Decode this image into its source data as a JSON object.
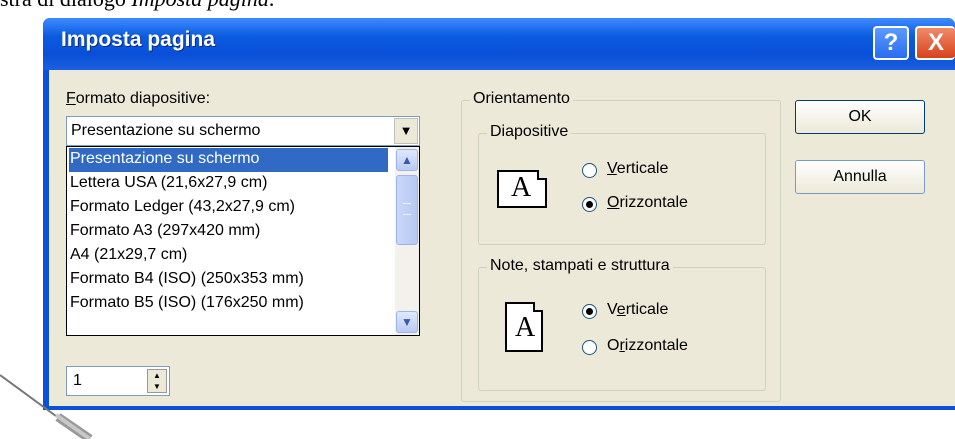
{
  "caption": {
    "text_prefix": "stra di dialogo ",
    "text_emphasis": "Imposta pagina",
    "text_suffix": "."
  },
  "window": {
    "title": "Imposta pagina",
    "help_label": "?",
    "close_label": "X"
  },
  "slide_format": {
    "label_accel": "F",
    "label_rest": "ormato diapositive:",
    "selected": "Presentazione su schermo",
    "options": [
      "Presentazione su schermo",
      "Lettera USA (21,6x27,9 cm)",
      "Formato Ledger (43,2x27,9 cm)",
      "Formato A3 (297x420 mm)",
      "A4 (21x29,7 cm)",
      "Formato B4 (ISO) (250x353 mm)",
      "Formato B5 (ISO) (176x250 mm)"
    ]
  },
  "numbering": {
    "value": "1"
  },
  "orientation": {
    "group_label": "Orientamento",
    "slides": {
      "label": "Diapositive",
      "portrait_accel": "V",
      "portrait_rest": "erticale",
      "landscape_accel": "O",
      "landscape_rest": "rizzontale",
      "selected": "Orizzontale"
    },
    "notes": {
      "label": "Note, stampati e struttura",
      "portrait_pre": "V",
      "portrait_accel": "e",
      "portrait_rest": "rticale",
      "landscape_pre": "O",
      "landscape_accel": "r",
      "landscape_rest": "izzontale",
      "selected": "Verticale"
    },
    "icon_letter": "A"
  },
  "buttons": {
    "ok": "OK",
    "cancel": "Annulla"
  },
  "colors": {
    "titlebar": "#0950d7",
    "selection": "#316ac5",
    "dialog_face": "#ece9d8"
  }
}
